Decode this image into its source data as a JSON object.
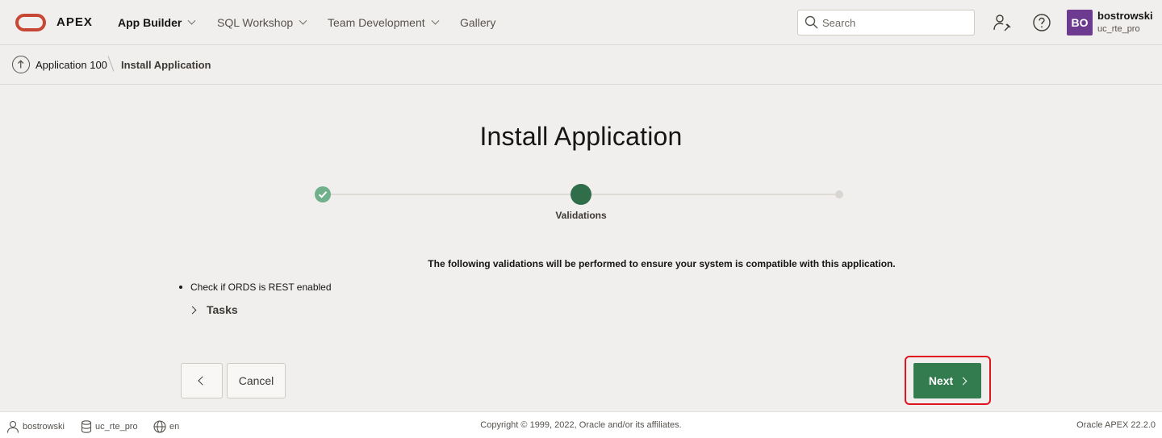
{
  "header": {
    "brand": "APEX",
    "nav": [
      {
        "label": "App Builder",
        "active": true
      },
      {
        "label": "SQL Workshop",
        "active": false
      },
      {
        "label": "Team Development",
        "active": false
      },
      {
        "label": "Gallery",
        "active": false
      }
    ],
    "search_placeholder": "Search",
    "user": {
      "initials": "BO",
      "name": "bostrowski",
      "workspace": "uc_rte_pro"
    },
    "colors": {
      "logo": "#c74634",
      "avatar": "#6c3a8f"
    }
  },
  "breadcrumb": {
    "parent": "Application 100",
    "current": "Install Application"
  },
  "main": {
    "title": "Install Application",
    "steps": [
      {
        "state": "complete",
        "label": ""
      },
      {
        "state": "current",
        "label": "Validations"
      },
      {
        "state": "pending",
        "label": ""
      }
    ],
    "intro": "The following validations will be performed to ensure your system is compatible with this application.",
    "validations": [
      "Check if ORDS is REST enabled"
    ],
    "tasks_label": "Tasks",
    "cancel_label": "Cancel",
    "next_label": "Next",
    "colors": {
      "next_button": "#327c50",
      "highlight": "#e0141e"
    }
  },
  "footer": {
    "user": "bostrowski",
    "workspace": "uc_rte_pro",
    "language": "en",
    "copyright": "Copyright © 1999, 2022, Oracle and/or its affiliates.",
    "version": "Oracle APEX 22.2.0"
  }
}
